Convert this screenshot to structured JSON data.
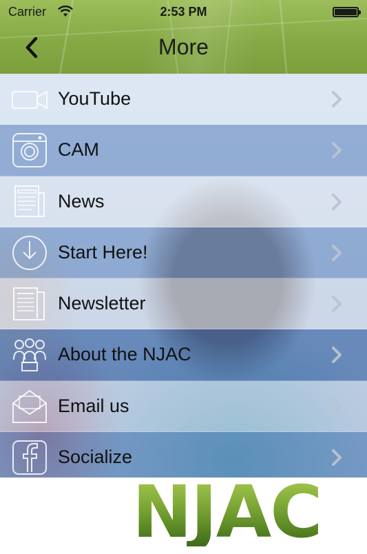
{
  "status_bar": {
    "carrier": "Carrier",
    "time": "2:53 PM"
  },
  "nav": {
    "title": "More"
  },
  "menu": {
    "items": [
      {
        "label": "YouTube",
        "icon": "video-camera-icon",
        "bg": "rgba(222,231,244,0.93)"
      },
      {
        "label": "CAM",
        "icon": "camera-icon",
        "bg": "rgba(126,160,209,0.72)"
      },
      {
        "label": "News",
        "icon": "newspaper-icon",
        "bg": "rgba(222,231,244,0.80)"
      },
      {
        "label": "Start Here!",
        "icon": "download-clock-icon",
        "bg": "rgba(126,160,209,0.70)"
      },
      {
        "label": "Newsletter",
        "icon": "document-icon",
        "bg": "rgba(214,225,242,0.70)"
      },
      {
        "label": "About the NJAC",
        "icon": "group-icon",
        "bg": "rgba(76,118,179,0.72)"
      },
      {
        "label": "Email us",
        "icon": "envelope-icon",
        "bg": "rgba(196,212,236,0.70)"
      },
      {
        "label": "Socialize",
        "icon": "facebook-icon",
        "bg": "rgba(108,145,198,0.72)"
      }
    ]
  },
  "footer": {
    "logo_text": "NJAC"
  },
  "colors": {
    "header_green": "#86a945",
    "logo_green": "#6e9b2e"
  }
}
